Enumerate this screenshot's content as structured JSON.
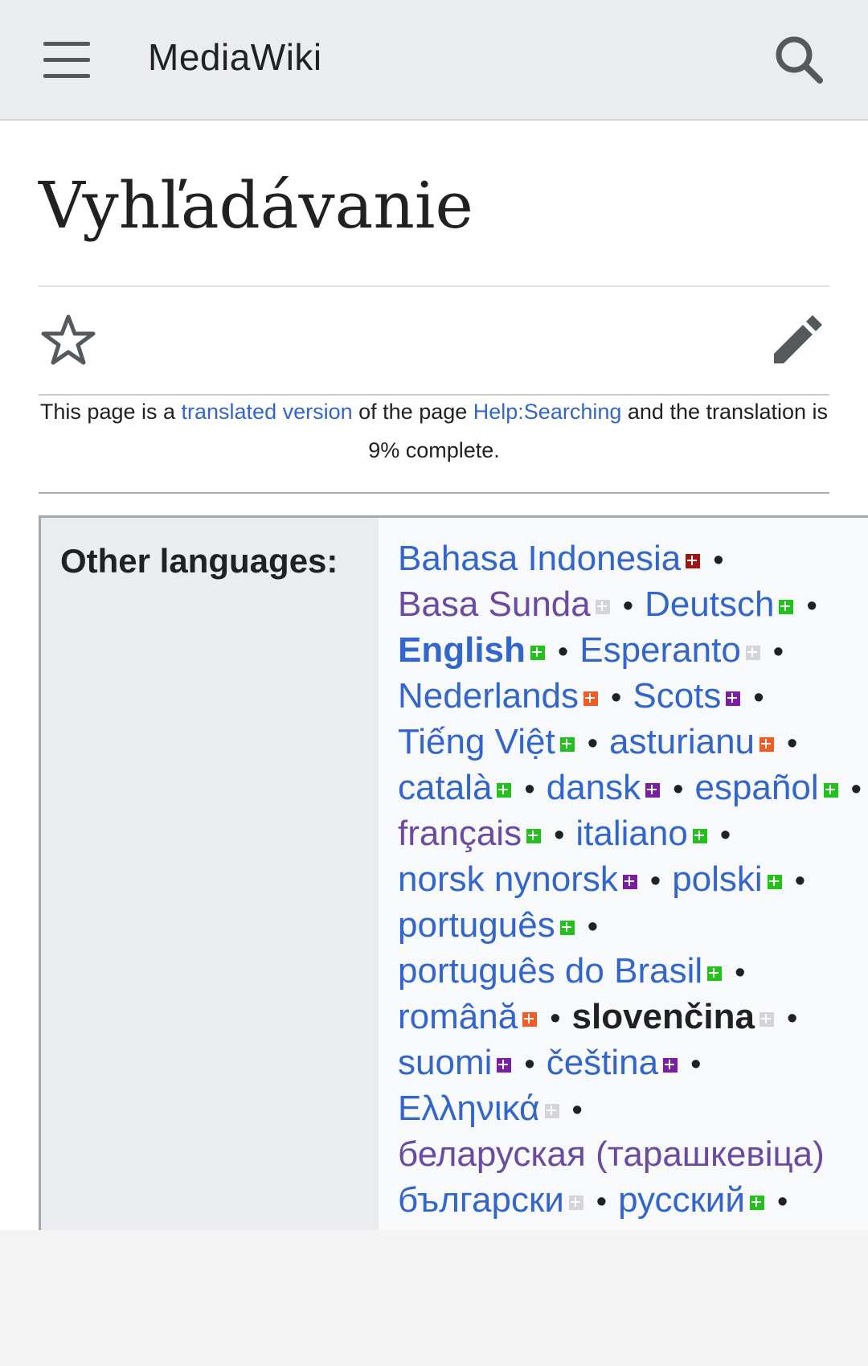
{
  "header": {
    "brand": "MediaWiki",
    "menu_icon": "hamburger-menu-icon",
    "search_icon": "search-icon"
  },
  "page": {
    "title": "Vyhľadávanie",
    "watch_icon": "star-icon",
    "edit_icon": "pencil-icon"
  },
  "notice": {
    "part1": "This page is a ",
    "link1": "translated version",
    "part2": " of the page ",
    "link2": "Help:Searching",
    "part3": " and the translation is 9% complete."
  },
  "languages": {
    "label": "Other languages:",
    "items": [
      {
        "name": "Bahasa Indonesia",
        "badge": "dark"
      },
      {
        "name": "Basa Sunda",
        "badge": "gray"
      },
      {
        "name": "Deutsch",
        "badge": "green"
      },
      {
        "name": "English",
        "badge": "green"
      },
      {
        "name": "Esperanto",
        "badge": "gray"
      },
      {
        "name": "Nederlands",
        "badge": "orange"
      },
      {
        "name": "Scots",
        "badge": "purple"
      },
      {
        "name": "Tiếng Việt",
        "badge": "green"
      },
      {
        "name": "asturianu",
        "badge": "orange"
      },
      {
        "name": "català",
        "badge": "green"
      },
      {
        "name": "dansk",
        "badge": "purple"
      },
      {
        "name": "español",
        "badge": "green"
      },
      {
        "name": "français",
        "badge": "green"
      },
      {
        "name": "italiano",
        "badge": "green"
      },
      {
        "name": "norsk nynorsk",
        "badge": "purple"
      },
      {
        "name": "polski",
        "badge": "green"
      },
      {
        "name": "português",
        "badge": "green"
      },
      {
        "name": "português do Brasil",
        "badge": "green"
      },
      {
        "name": "română",
        "badge": "orange"
      },
      {
        "name": "slovenčina",
        "badge": "gray"
      },
      {
        "name": "suomi",
        "badge": "purple"
      },
      {
        "name": "čeština",
        "badge": "purple"
      },
      {
        "name": "Ελληνικά",
        "badge": "gray"
      },
      {
        "name": "беларуская (тарашкевіца)",
        "badge": "none"
      },
      {
        "name": "български",
        "badge": "gray"
      },
      {
        "name": "русский",
        "badge": "green"
      }
    ],
    "separator": "•"
  },
  "colors": {
    "link": "#3366cc",
    "visited": "#6b4ba1",
    "text": "#202122",
    "header_bg": "#eaecf0"
  }
}
